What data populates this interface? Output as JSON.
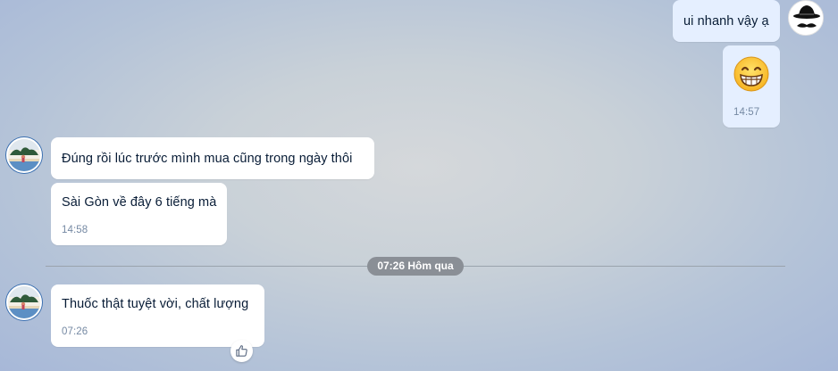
{
  "conversation": {
    "messages": [
      {
        "sender": "me",
        "text": "ui nhanh vậy ạ"
      },
      {
        "sender": "me",
        "type": "emoji",
        "emoji": "grinning-face-emoji",
        "time": "14:57"
      },
      {
        "sender": "friend",
        "text": "Đúng rồi lúc trước mình mua cũng trong ngày thôi"
      },
      {
        "sender": "friend",
        "text": "Sài Gòn về đây 6 tiếng mà",
        "time": "14:58"
      },
      {
        "sender": "friend",
        "text": "Thuốc thật tuyệt vời, chất lượng",
        "time": "07:26"
      }
    ],
    "divider": {
      "label": "07:26 Hôm qua"
    }
  },
  "icons": {
    "like": "thumbs-up-icon",
    "my_avatar": "cowboy-hat-mustache-avatar",
    "friend_avatar": "landscape-photo-avatar"
  },
  "colors": {
    "incoming_bubble": "#ffffff",
    "outgoing_bubble": "#e5efff",
    "timestamp": "#7589a3",
    "divider_pill": "#8a8f96"
  }
}
